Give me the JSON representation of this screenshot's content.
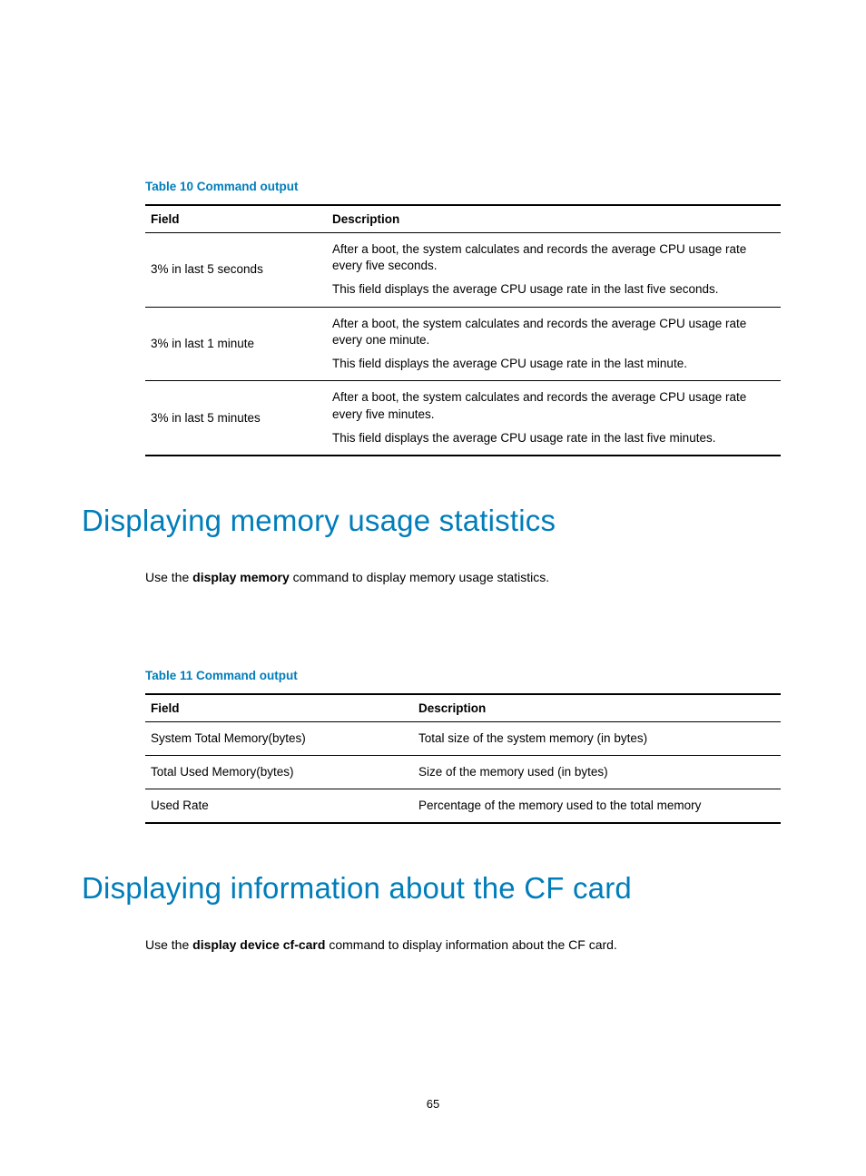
{
  "table10": {
    "caption": "Table 10 Command output",
    "headers": [
      "Field",
      "Description"
    ],
    "rows": [
      {
        "field": "3% in last 5 seconds",
        "desc": [
          "After a boot, the system calculates and records the average CPU usage rate every five seconds.",
          "This field displays the average CPU usage rate in the last five seconds."
        ]
      },
      {
        "field": "3% in last 1 minute",
        "desc": [
          "After a boot, the system calculates and records the average CPU usage rate every one minute.",
          "This field displays the average CPU usage rate in the last minute."
        ]
      },
      {
        "field": "3% in last 5 minutes",
        "desc": [
          "After a boot, the system calculates and records the average CPU usage rate every five minutes.",
          "This field displays the average CPU usage rate in the last five minutes."
        ]
      }
    ]
  },
  "heading1": "Displaying memory usage statistics",
  "para1": {
    "pre": "Use the ",
    "bold": "display memory",
    "post": " command to display memory usage statistics."
  },
  "table11": {
    "caption": "Table 11 Command output",
    "headers": [
      "Field",
      "Description"
    ],
    "rows": [
      {
        "field": "System Total Memory(bytes)",
        "desc": "Total size of the system memory (in bytes)"
      },
      {
        "field": "Total Used Memory(bytes)",
        "desc": "Size of the memory used (in bytes)"
      },
      {
        "field": "Used Rate",
        "desc": "Percentage of the memory used to the total memory"
      }
    ]
  },
  "heading2": "Displaying information about the CF card",
  "para2": {
    "pre": "Use the ",
    "bold": "display device cf-card",
    "post": " command to display information about the CF card."
  },
  "pageNumber": "65"
}
